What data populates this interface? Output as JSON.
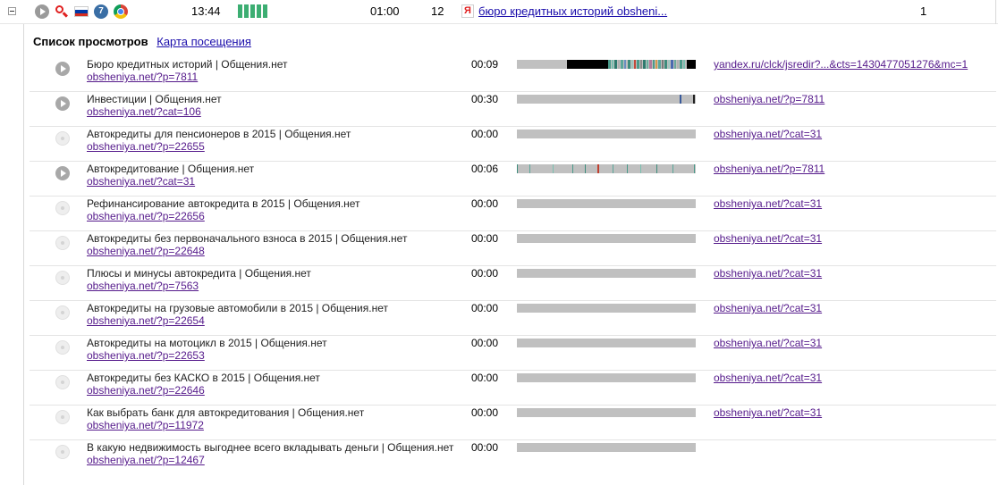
{
  "summary": {
    "time": "13:44",
    "activity_bars": 5,
    "duration": "01:00",
    "pages": "12",
    "yandex_glyph": "Я",
    "link_text": "бюро кредитных историй obsheni...",
    "count": "1",
    "win_glyph": "7",
    "icons": [
      "play-icon",
      "search-icon",
      "flag-ru-icon",
      "windows-icon",
      "chrome-icon"
    ]
  },
  "tabs": {
    "active": "Список просмотров",
    "link": "Карта посещения"
  },
  "colors": {
    "flag": [
      "#ffffff",
      "#0039a6",
      "#d52b1e"
    ],
    "bar_bg": "#c0c0c0",
    "activity": "#3cae72"
  },
  "rows": [
    {
      "title": "Бюро кредитных историй | Общения.нет",
      "url": "obsheniya.net/?p=7811",
      "time": "00:09",
      "referrer": "yandex.ru/clck/jsredir?...&cts=1430477051276&mc=1",
      "played": true,
      "bar": "heavy"
    },
    {
      "title": "Инвестиции | Общения.нет",
      "url": "obsheniya.net/?cat=106",
      "time": "00:30",
      "referrer": "obsheniya.net/?p=7811",
      "played": true,
      "bar": "end-marks"
    },
    {
      "title": "Автокредиты для пенсионеров в 2015 | Общения.нет",
      "url": "obsheniya.net/?p=22655",
      "time": "00:00",
      "referrer": "obsheniya.net/?cat=31",
      "played": false,
      "bar": "empty"
    },
    {
      "title": "Автокредитование | Общения.нет",
      "url": "obsheniya.net/?cat=31",
      "time": "00:06",
      "referrer": "obsheniya.net/?p=7811",
      "played": true,
      "bar": "sparse"
    },
    {
      "title": "Рефинансирование автокредита в 2015 | Общения.нет",
      "url": "obsheniya.net/?p=22656",
      "time": "00:00",
      "referrer": "obsheniya.net/?cat=31",
      "played": false,
      "bar": "empty"
    },
    {
      "title": "Автокредиты без первоначального взноса в 2015 | Общения.нет",
      "url": "obsheniya.net/?p=22648",
      "time": "00:00",
      "referrer": "obsheniya.net/?cat=31",
      "played": false,
      "bar": "empty"
    },
    {
      "title": "Плюсы и минусы автокредита | Общения.нет",
      "url": "obsheniya.net/?p=7563",
      "time": "00:00",
      "referrer": "obsheniya.net/?cat=31",
      "played": false,
      "bar": "empty"
    },
    {
      "title": "Автокредиты на грузовые автомобили в 2015 | Общения.нет",
      "url": "obsheniya.net/?p=22654",
      "time": "00:00",
      "referrer": "obsheniya.net/?cat=31",
      "played": false,
      "bar": "empty"
    },
    {
      "title": "Автокредиты на мотоцикл в 2015 | Общения.нет",
      "url": "obsheniya.net/?p=22653",
      "time": "00:00",
      "referrer": "obsheniya.net/?cat=31",
      "played": false,
      "bar": "empty"
    },
    {
      "title": "Автокредиты без КАСКО в 2015 | Общения.нет",
      "url": "obsheniya.net/?p=22646",
      "time": "00:00",
      "referrer": "obsheniya.net/?cat=31",
      "played": false,
      "bar": "empty"
    },
    {
      "title": "Как выбрать банк для автокредитования | Общения.нет",
      "url": "obsheniya.net/?p=11972",
      "time": "00:00",
      "referrer": "obsheniya.net/?cat=31",
      "played": false,
      "bar": "empty"
    },
    {
      "title": "В какую недвижимость выгоднее всего вкладывать деньги | Общения.нет",
      "url": "obsheniya.net/?p=12467",
      "time": "00:00",
      "referrer": "",
      "played": false,
      "bar": "empty"
    }
  ]
}
